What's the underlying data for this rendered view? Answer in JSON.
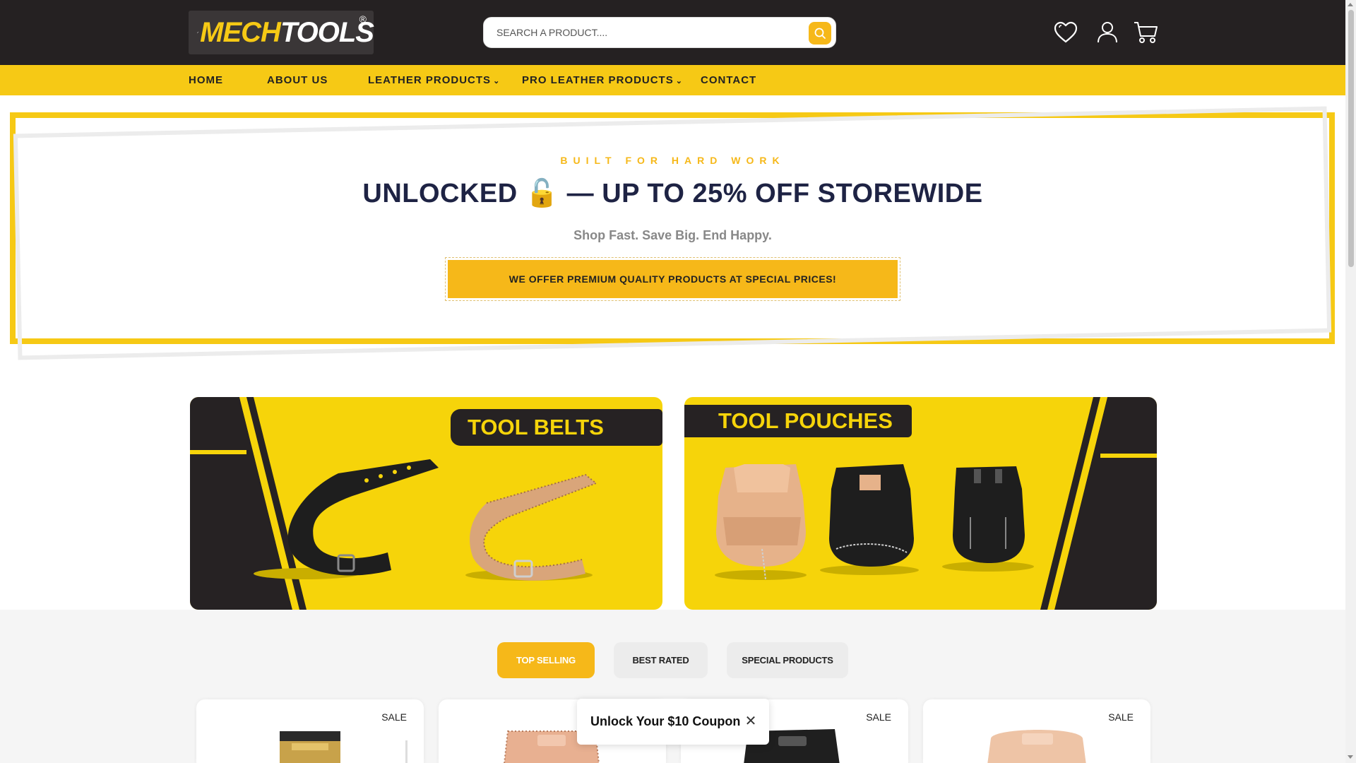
{
  "header": {
    "logo_text_a": "MECH",
    "logo_text_b": "TOOLS",
    "logo_reg": "®",
    "search": {
      "placeholder": "SEARCH A PRODUCT...."
    },
    "icons": [
      "search-icon",
      "heart-icon",
      "user-icon",
      "cart-icon"
    ]
  },
  "nav": {
    "items": [
      {
        "label": "HOME"
      },
      {
        "label": "ABOUT US"
      },
      {
        "label": "LEATHER PRODUCTS",
        "dropdown": true
      },
      {
        "label": "PRO LEATHER PRODUCTS",
        "dropdown": true
      },
      {
        "label": "CONTACT"
      }
    ],
    "chevron": "⌄"
  },
  "promo": {
    "kicker": "BUILT FOR HARD WORK",
    "title": "UNLOCKED 🔓 — UP TO 25% OFF STOREWIDE",
    "subtitle": "Shop Fast. Save Big. End Happy.",
    "cta": "WE OFFER PREMIUM QUALITY PRODUCTS AT SPECIAL PRICES!"
  },
  "banners": [
    {
      "label": "TOOL BELTS"
    },
    {
      "label": "TOOL POUCHES"
    }
  ],
  "tabs": [
    {
      "label": "TOP SELLING",
      "active": true
    },
    {
      "label": "BEST RATED",
      "active": false
    },
    {
      "label": "SPECIAL PRODUCTS",
      "active": false
    }
  ],
  "products": [
    {
      "badge": "SALE"
    },
    {
      "badge": ""
    },
    {
      "badge": "SALE"
    },
    {
      "badge": "SALE"
    }
  ],
  "coupon": {
    "text": "Unlock Your $10 Coupon",
    "close": "✕"
  },
  "colors": {
    "brand_yellow": "#f6c915",
    "accent_orange": "#f6b819",
    "dark": "#252122",
    "navy": "#1e2344"
  }
}
